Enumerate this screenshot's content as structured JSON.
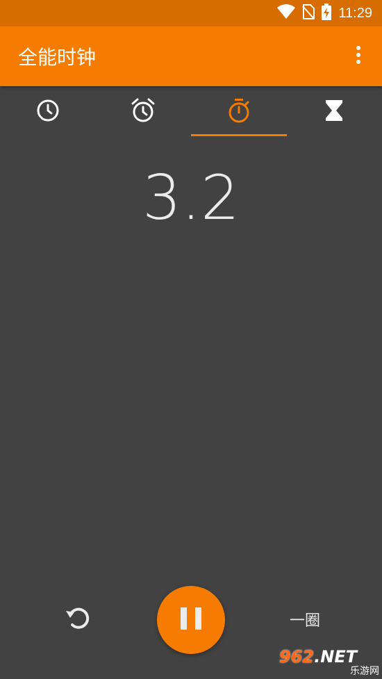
{
  "status_bar": {
    "time": "11:29",
    "icons": [
      "wifi-icon",
      "no-sim-icon",
      "battery-charging-icon"
    ]
  },
  "app_bar": {
    "title": "全能时钟",
    "overflow_icon": "more-vert-icon"
  },
  "tabs": [
    {
      "name": "clock",
      "icon": "clock-icon",
      "selected": false
    },
    {
      "name": "alarm",
      "icon": "alarm-icon",
      "selected": false
    },
    {
      "name": "stopwatch",
      "icon": "stopwatch-icon",
      "selected": true
    },
    {
      "name": "timer",
      "icon": "hourglass-icon",
      "selected": false
    }
  ],
  "stopwatch": {
    "elapsed": "3.2"
  },
  "controls": {
    "reset_icon": "reset-icon",
    "pause_icon": "pause-icon",
    "lap_label": "一圈"
  },
  "watermark": {
    "main_num": "962",
    "main_suffix": ".NET",
    "sub": "乐游网"
  },
  "colors": {
    "accent": "#F57C00",
    "status_bar": "#D76C00",
    "background": "#424242",
    "text": "#ECECEC"
  }
}
